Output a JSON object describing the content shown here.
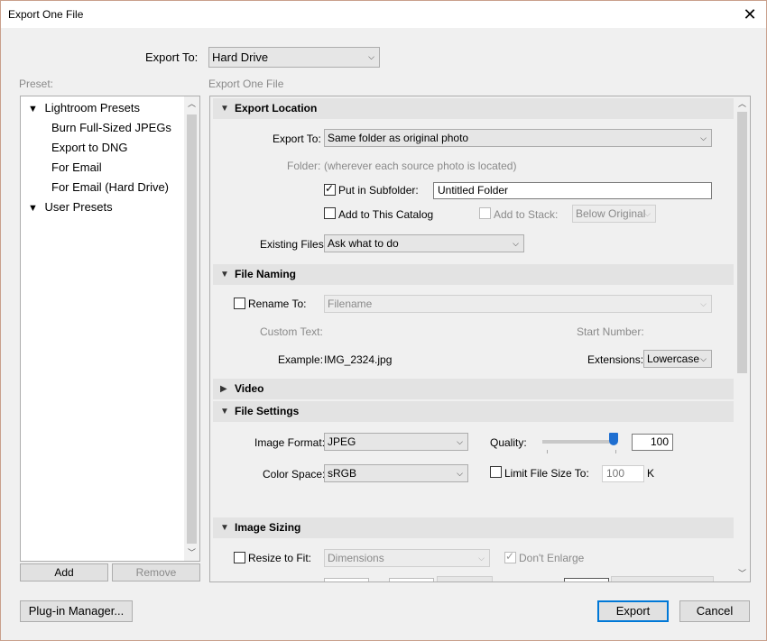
{
  "window": {
    "title": "Export One File",
    "close_glyph": "✕"
  },
  "export_to": {
    "label": "Export To:",
    "value": "Hard Drive"
  },
  "preset": {
    "label": "Preset:",
    "groups": [
      {
        "name": "Lightroom Presets",
        "items": [
          "Burn Full-Sized JPEGs",
          "Export to DNG",
          "For Email",
          "For Email (Hard Drive)"
        ]
      },
      {
        "name": "User Presets",
        "items": []
      }
    ],
    "add_label": "Add",
    "remove_label": "Remove"
  },
  "panel_title": "Export One File",
  "export_location": {
    "header": "Export Location",
    "export_to_label": "Export To:",
    "export_to_value": "Same folder as original photo",
    "folder_label": "Folder:",
    "folder_value": "(wherever each source photo is located)",
    "put_in_subfolder_label": "Put in Subfolder:",
    "put_in_subfolder_checked": true,
    "subfolder_value": "Untitled Folder",
    "add_to_catalog_label": "Add to This Catalog",
    "add_to_catalog_checked": false,
    "add_to_stack_label": "Add to Stack:",
    "add_to_stack_value": "Below Original",
    "existing_files_label": "Existing Files:",
    "existing_files_value": "Ask what to do"
  },
  "file_naming": {
    "header": "File Naming",
    "rename_to_label": "Rename To:",
    "rename_to_value": "Filename",
    "custom_text_label": "Custom Text:",
    "start_number_label": "Start Number:",
    "example_label": "Example:",
    "example_value": "IMG_2324.jpg",
    "extensions_label": "Extensions:",
    "extensions_value": "Lowercase"
  },
  "video": {
    "header": "Video"
  },
  "file_settings": {
    "header": "File Settings",
    "image_format_label": "Image Format:",
    "image_format_value": "JPEG",
    "quality_label": "Quality:",
    "quality_value": "100",
    "quality_level": 1.0,
    "color_space_label": "Color Space:",
    "color_space_value": "sRGB",
    "limit_size_label": "Limit File Size To:",
    "limit_size_value": "100",
    "limit_size_unit": "K"
  },
  "image_sizing": {
    "header": "Image Sizing",
    "resize_label": "Resize to Fit:",
    "resize_value": "Dimensions",
    "dont_enlarge_label": "Don't Enlarge",
    "dont_enlarge_checked": true
  },
  "footer": {
    "plugin_manager_label": "Plug-in Manager...",
    "export_label": "Export",
    "cancel_label": "Cancel"
  },
  "glyphs": {
    "chevron_down": "⌵",
    "triangle_down": "▼",
    "triangle_right": "▶",
    "scroll_up": "︿",
    "scroll_down": "﹀"
  }
}
